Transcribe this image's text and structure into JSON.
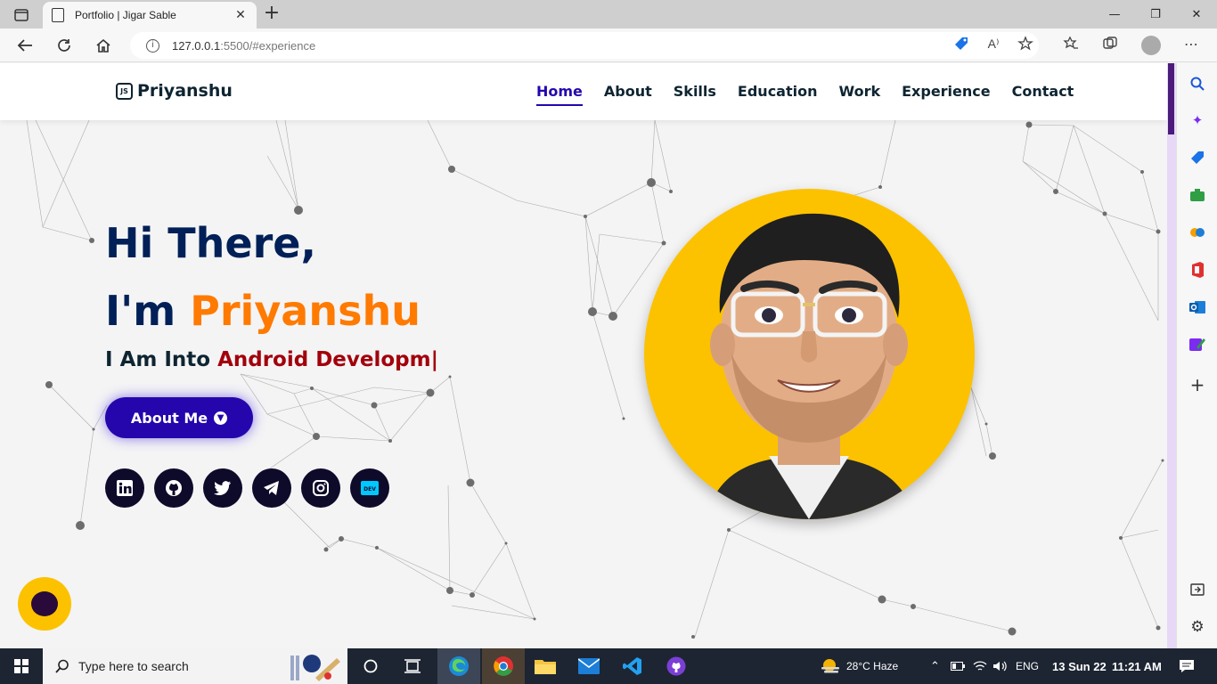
{
  "browser": {
    "tab_title": "Portfolio | Jigar Sable",
    "tab_close": "✕",
    "new_tab": "+",
    "url_host": "127.0.0.1",
    "url_rest": ":5500/#experience",
    "window_controls": [
      "—",
      "❐",
      "✕"
    ],
    "read_aloud": "A⁾"
  },
  "site": {
    "logo_text": "Priyanshu",
    "logo_badge": "JS",
    "nav": [
      "Home",
      "About",
      "Skills",
      "Education",
      "Work",
      "Experience",
      "Contact"
    ],
    "active_nav": "Home",
    "greeting": "Hi There,",
    "im": "I'm ",
    "name": "Priyanshu",
    "typed_prefix": "I Am Into ",
    "typed_role": "Android Developm|",
    "about_button": "About Me",
    "socials": [
      "linkedin-icon",
      "github-icon",
      "twitter-icon",
      "telegram-icon",
      "instagram-icon",
      "dev-icon"
    ],
    "accent": "#2506ad",
    "highlight": "#ff7a00",
    "role_color": "#a2000b",
    "portrait_bg": "#fcc200"
  },
  "taskbar": {
    "search_placeholder": "Type here to search",
    "weather": "28°C  Haze",
    "language": "ENG",
    "date": "13 Sun 22",
    "time": "11:21 AM"
  }
}
